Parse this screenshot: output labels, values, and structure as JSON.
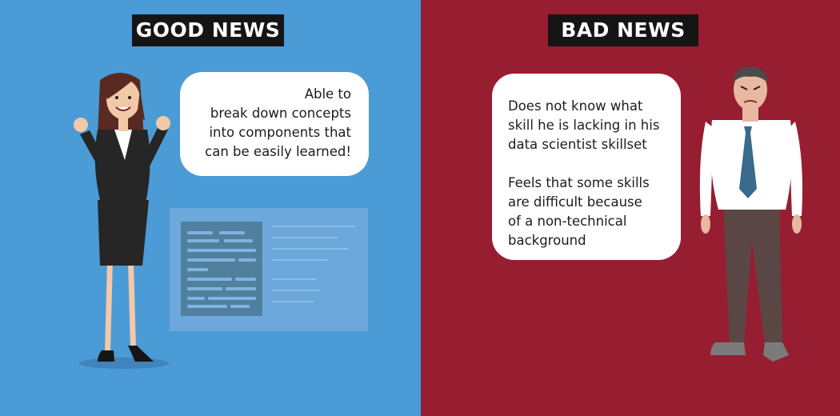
{
  "left_panel": {
    "banner": "GOOD NEWS",
    "bubble_lines": [
      "Able to",
      "break down concepts",
      "into components that",
      "can be easily learned!"
    ],
    "background_color": "#4a9bd6",
    "figure_icon": "businesswoman-celebrating-illustration",
    "board_icon": "document-board-illustration"
  },
  "right_panel": {
    "banner": "BAD NEWS",
    "bubble_paragraph_1": [
      "Does not know what",
      "skill he is lacking in his",
      "data scientist skillset"
    ],
    "bubble_paragraph_2": [
      "Feels that some skills",
      "are difficult because",
      "of a non-technical",
      "background"
    ],
    "background_color": "#971d31",
    "figure_icon": "frowning-businessman-illustration"
  }
}
